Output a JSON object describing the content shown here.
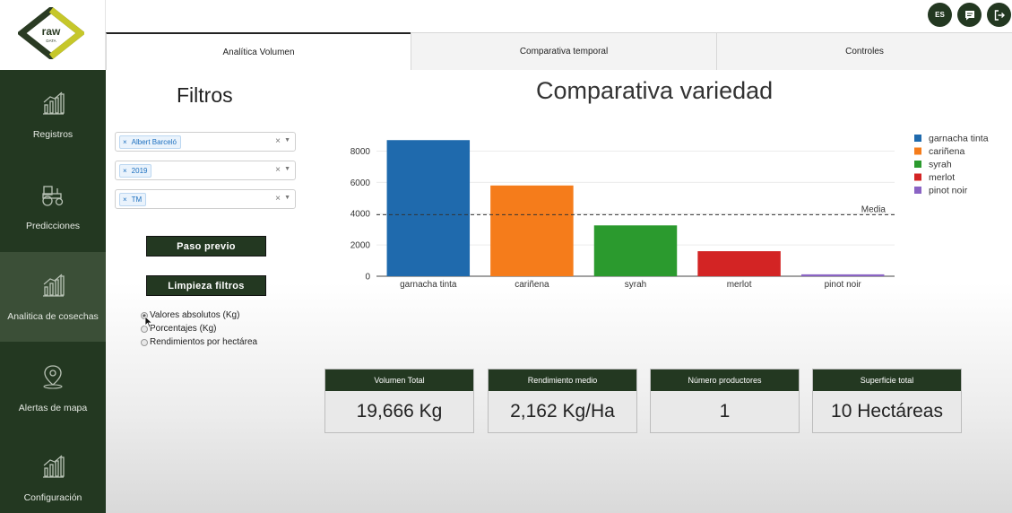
{
  "logo": {
    "text": "raw",
    "subtext": "DATA"
  },
  "sidebar": {
    "items": [
      {
        "label": "Registros",
        "icon": "bar-chart-icon"
      },
      {
        "label": "Predicciones",
        "icon": "tractor-icon"
      },
      {
        "label": "Analitica de cosechas",
        "icon": "bar-chart-icon",
        "active": true
      },
      {
        "label": "Alertas de mapa",
        "icon": "map-pin-icon"
      },
      {
        "label": "Configuración",
        "icon": "bar-chart-icon"
      }
    ]
  },
  "topbar": {
    "language": "ES",
    "chat_icon": "chat-icon",
    "logout_icon": "logout-icon"
  },
  "tabs": [
    {
      "label": "Analítica Volumen",
      "active": true
    },
    {
      "label": "Comparativa temporal"
    },
    {
      "label": "Controles"
    }
  ],
  "filters": {
    "title": "Filtros",
    "selects": [
      {
        "value": "Albert Barceló"
      },
      {
        "value": "2019"
      },
      {
        "value": "TM"
      }
    ],
    "prev_button": "Paso previo",
    "clear_button": "Limpieza filtros",
    "radios": [
      {
        "label": "Valores absolutos (Kg)",
        "checked": true
      },
      {
        "label": "Porcentajes (Kg)"
      },
      {
        "label": "Rendimientos por hectárea"
      }
    ]
  },
  "chart_data": {
    "type": "bar",
    "title": "Comparativa variedad",
    "categories": [
      "garnacha tinta",
      "cariñena",
      "syrah",
      "merlot",
      "pinot noir"
    ],
    "values": [
      8700,
      5800,
      3250,
      1600,
      120
    ],
    "colors": [
      "#1f6aad",
      "#f57c1b",
      "#2b9a2e",
      "#d32424",
      "#8a63c4"
    ],
    "ylim": [
      0,
      9000
    ],
    "yticks": [
      0,
      2000,
      4000,
      6000,
      8000
    ],
    "reference_line": {
      "label": "Media",
      "value": 3933
    },
    "legend": [
      "garnacha tinta",
      "cariñena",
      "syrah",
      "merlot",
      "pinot noir"
    ],
    "legend_position": "top-right",
    "grid": true
  },
  "kpis": [
    {
      "label": "Volumen Total",
      "value": "19,666 Kg"
    },
    {
      "label": "Rendimiento medio",
      "value": "2,162 Kg/Ha"
    },
    {
      "label": "Número productores",
      "value": "1"
    },
    {
      "label": "Superficie total",
      "value": "10 Hectáreas"
    }
  ]
}
